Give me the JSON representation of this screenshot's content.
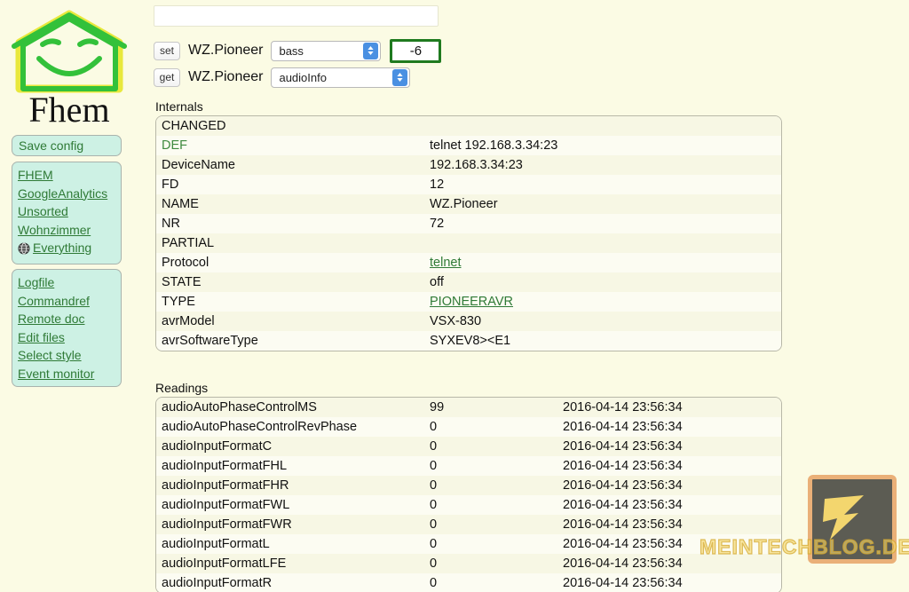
{
  "app": {
    "name": "Fhem",
    "logo_icon": "house-smiley-icon"
  },
  "sidebar": {
    "save_config_label": "Save config",
    "rooms": [
      {
        "label": "FHEM",
        "icon": null
      },
      {
        "label": "GoogleAnalytics",
        "icon": null
      },
      {
        "label": "Unsorted",
        "icon": null
      },
      {
        "label": "Wohnzimmer",
        "icon": null
      },
      {
        "label": "Everything",
        "icon": "globe-icon"
      }
    ],
    "tools": [
      {
        "label": "Logfile"
      },
      {
        "label": "Commandref"
      },
      {
        "label": "Remote doc"
      },
      {
        "label": "Edit files"
      },
      {
        "label": "Select style"
      },
      {
        "label": "Event monitor"
      }
    ]
  },
  "command_bar": {
    "input_value": "",
    "input_placeholder": "",
    "set": {
      "button_label": "set",
      "device": "WZ.Pioneer",
      "selected_option": "bass",
      "value": "-6",
      "value_border_color": "#1f7a1f"
    },
    "get": {
      "button_label": "get",
      "device": "WZ.Pioneer",
      "selected_option": "audioInfo"
    },
    "dropdown_arrow_color": "#4a90e2"
  },
  "internals": {
    "title": "Internals",
    "rows": [
      {
        "name": "CHANGED",
        "name_link": false,
        "value": "",
        "value_link": false
      },
      {
        "name": "DEF",
        "name_link": true,
        "value": "telnet 192.168.3.34:23",
        "value_link": false
      },
      {
        "name": "DeviceName",
        "name_link": false,
        "value": "192.168.3.34:23",
        "value_link": false
      },
      {
        "name": "FD",
        "name_link": false,
        "value": "12",
        "value_link": false
      },
      {
        "name": "NAME",
        "name_link": false,
        "value": "WZ.Pioneer",
        "value_link": false
      },
      {
        "name": "NR",
        "name_link": false,
        "value": "72",
        "value_link": false
      },
      {
        "name": "PARTIAL",
        "name_link": false,
        "value": "",
        "value_link": false
      },
      {
        "name": "Protocol",
        "name_link": false,
        "value": "telnet",
        "value_link": true
      },
      {
        "name": "STATE",
        "name_link": false,
        "value": "off",
        "value_link": false
      },
      {
        "name": "TYPE",
        "name_link": false,
        "value": "PIONEERAVR",
        "value_link": true
      },
      {
        "name": "avrModel",
        "name_link": false,
        "value": "VSX-830",
        "value_link": false
      },
      {
        "name": "avrSoftwareType",
        "name_link": false,
        "value": "SYXEV8><E1",
        "value_link": false
      }
    ]
  },
  "readings": {
    "title": "Readings",
    "rows": [
      {
        "name": "audioAutoPhaseControlMS",
        "value": "99",
        "time": "2016-04-14 23:56:34"
      },
      {
        "name": "audioAutoPhaseControlRevPhase",
        "value": "0",
        "time": "2016-04-14 23:56:34"
      },
      {
        "name": "audioInputFormatC",
        "value": "0",
        "time": "2016-04-14 23:56:34"
      },
      {
        "name": "audioInputFormatFHL",
        "value": "0",
        "time": "2016-04-14 23:56:34"
      },
      {
        "name": "audioInputFormatFHR",
        "value": "0",
        "time": "2016-04-14 23:56:34"
      },
      {
        "name": "audioInputFormatFWL",
        "value": "0",
        "time": "2016-04-14 23:56:34"
      },
      {
        "name": "audioInputFormatFWR",
        "value": "0",
        "time": "2016-04-14 23:56:34"
      },
      {
        "name": "audioInputFormatL",
        "value": "0",
        "time": "2016-04-14 23:56:34"
      },
      {
        "name": "audioInputFormatLFE",
        "value": "0",
        "time": "2016-04-14 23:56:34"
      },
      {
        "name": "audioInputFormatR",
        "value": "0",
        "time": "2016-04-14 23:56:34"
      }
    ]
  },
  "watermark": {
    "text": "MEINTECHBLOG.DE",
    "icon": "lightning-badge-icon"
  },
  "colors": {
    "page_bg": "#fbfbe4",
    "link_green": "#2f7a36",
    "sidebar_box_bg": "#cdf1e4",
    "row_odd": "#f7f7e4",
    "row_even": "#fcfcf2"
  }
}
